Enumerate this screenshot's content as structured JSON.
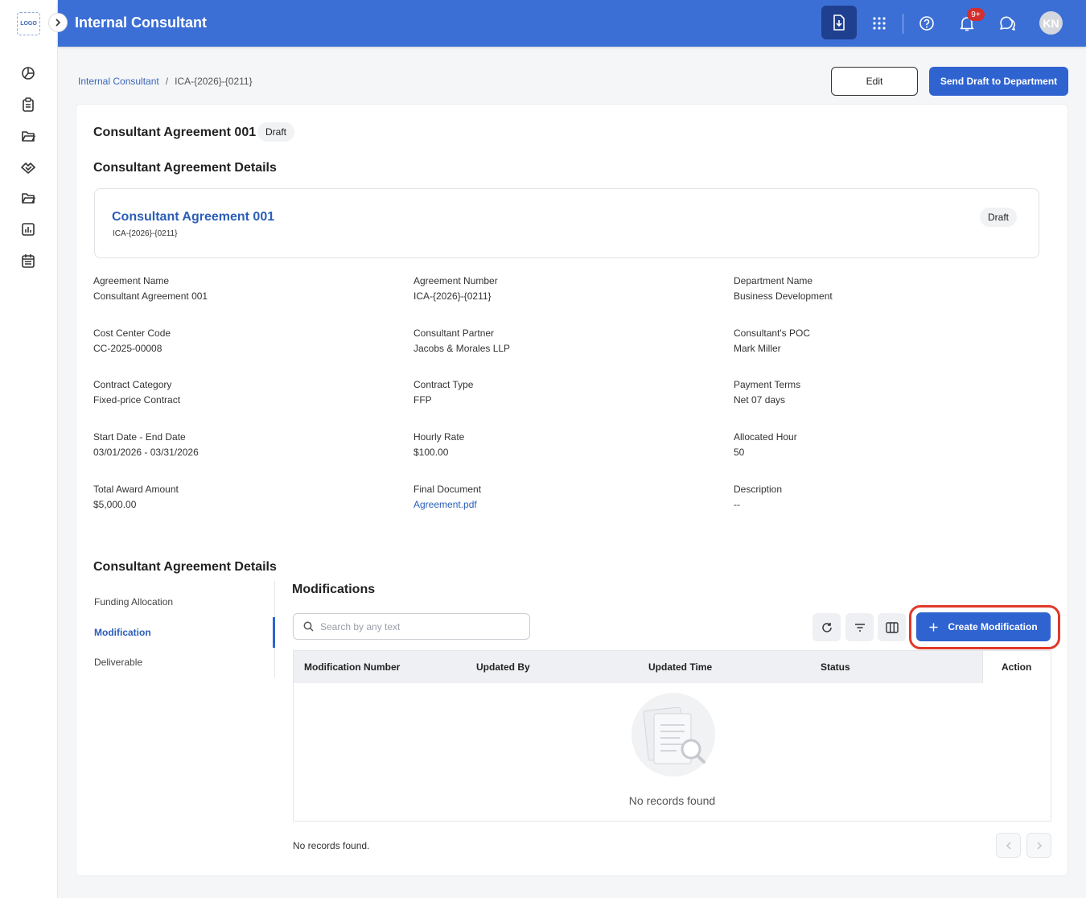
{
  "app": {
    "logo_text": "LOGO",
    "title": "Internal Consultant",
    "notifications": "9+",
    "avatar_initials": "KN"
  },
  "breadcrumb": {
    "root": "Internal Consultant",
    "separator": "/",
    "current": "ICA-{2026}-{0211}"
  },
  "actions": {
    "edit": "Edit",
    "send": "Send Draft to Department"
  },
  "header": {
    "title": "Consultant Agreement 001",
    "status": "Draft"
  },
  "details_section_title": "Consultant Agreement Details",
  "summary": {
    "name": "Consultant Agreement 001",
    "number": "ICA-{2026}-{0211}",
    "status": "Draft"
  },
  "fields": [
    {
      "label": "Agreement Name",
      "value": "Consultant Agreement 001"
    },
    {
      "label": "Agreement Number",
      "value": "ICA-{2026}-{0211}"
    },
    {
      "label": "Department Name",
      "value": "Business Development"
    },
    {
      "label": "Cost Center Code",
      "value": "CC-2025-00008"
    },
    {
      "label": "Consultant Partner",
      "value": "Jacobs & Morales LLP"
    },
    {
      "label": "Consultant's POC",
      "value": "Mark Miller"
    },
    {
      "label": "Contract Category",
      "value": "Fixed-price Contract"
    },
    {
      "label": "Contract Type",
      "value": "FFP"
    },
    {
      "label": "Payment Terms",
      "value": "Net 07 days"
    },
    {
      "label": "Start Date - End Date",
      "value": "03/01/2026 - 03/31/2026"
    },
    {
      "label": "Hourly Rate",
      "value": "$100.00"
    },
    {
      "label": "Allocated Hour",
      "value": "50"
    },
    {
      "label": "Total Award Amount",
      "value": "$5,000.00"
    },
    {
      "label": "Final Document",
      "value": "Agreement.pdf"
    },
    {
      "label": "Description",
      "value": "--"
    }
  ],
  "sub_section_title": "Consultant Agreement Details",
  "sub_nav": [
    "Funding Allocation",
    "Modification",
    "Deliverable"
  ],
  "modifications": {
    "title": "Modifications",
    "search_placeholder": "Search by any text",
    "create_label": "Create Modification",
    "columns": [
      "Modification Number",
      "Updated By",
      "Updated Time",
      "Status",
      "Action"
    ],
    "rows": [],
    "empty_text": "No records found",
    "footer_text": "No records found."
  },
  "colors": {
    "topbar": "#3b6fd6",
    "primary": "#2f63d0",
    "link": "#2b5eb8",
    "highlight": "#e0392b",
    "badge": "#d32f2f"
  }
}
